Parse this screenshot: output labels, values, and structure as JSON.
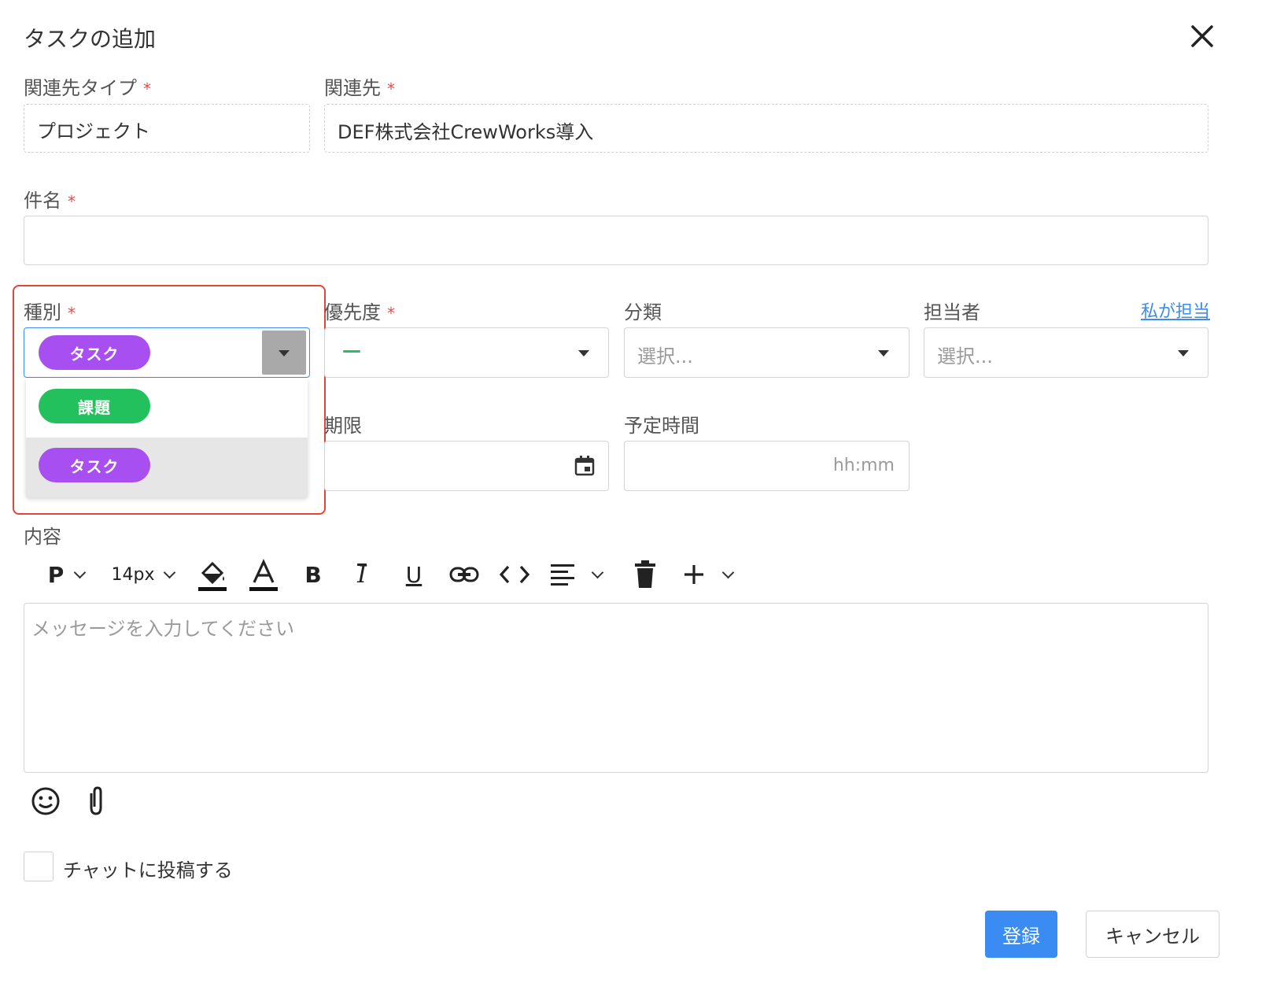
{
  "dialog": {
    "title": "タスクの追加"
  },
  "fields": {
    "related_type": {
      "label": "関連先タイプ",
      "required_mark": "*",
      "value": "プロジェクト"
    },
    "related_to": {
      "label": "関連先",
      "required_mark": "*",
      "value": "DEF株式会社CrewWorks導入"
    },
    "subject": {
      "label": "件名",
      "required_mark": "*",
      "value": ""
    },
    "type": {
      "label": "種別",
      "required_mark": "*",
      "selected": "タスク",
      "options": [
        {
          "label": "課題",
          "color": "#22c15e"
        },
        {
          "label": "タスク",
          "color": "#a84ff2"
        }
      ]
    },
    "priority": {
      "label": "優先度",
      "required_mark": "*",
      "value": "—",
      "value_color": "#22c15e"
    },
    "category": {
      "label": "分類",
      "placeholder": "選択..."
    },
    "assignee": {
      "label": "担当者",
      "placeholder": "選択...",
      "assign_me_link": "私が担当"
    },
    "due": {
      "label": "期限"
    },
    "estimated_time": {
      "label": "予定時間",
      "placeholder": "hh:mm"
    },
    "content": {
      "label": "内容",
      "placeholder": "メッセージを入力してください"
    }
  },
  "toolbar": {
    "paragraph": "P",
    "font_size": "14px",
    "icons": [
      "paint-bucket-icon",
      "text-color-icon",
      "bold-icon",
      "italic-icon",
      "underline-icon",
      "link-icon",
      "code-icon",
      "align-icon",
      "trash-icon",
      "plus-icon"
    ],
    "bold": "B",
    "italic": "I",
    "underline": "U",
    "text_color": "A"
  },
  "post_to_chat": {
    "label": "チャットに投稿する",
    "checked": false
  },
  "buttons": {
    "submit": "登録",
    "cancel": "キャンセル"
  },
  "colors": {
    "primary": "#3b8cf2",
    "highlight_border": "#e0463c",
    "selected_pill": "#a84ff2",
    "green_pill": "#22c15e"
  }
}
